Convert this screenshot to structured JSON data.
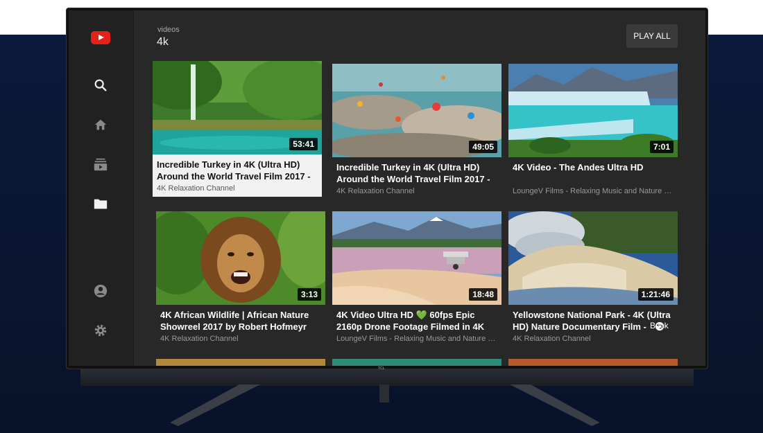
{
  "header": {
    "subtitle": "videos",
    "title": "4k",
    "play_all_label": "PLAY ALL"
  },
  "sidebar": {
    "items": [
      {
        "name": "search",
        "icon": "search-icon"
      },
      {
        "name": "home",
        "icon": "home-icon"
      },
      {
        "name": "subscriptions",
        "icon": "subscriptions-icon"
      },
      {
        "name": "library",
        "icon": "folder-icon"
      },
      {
        "name": "account",
        "icon": "account-icon"
      },
      {
        "name": "settings",
        "icon": "gear-icon"
      }
    ]
  },
  "videos": [
    {
      "title": "Incredible Turkey in 4K (Ultra HD) Around the World Travel Film 2017 -",
      "channel": "4K Relaxation Channel",
      "duration": "53:41",
      "focused": true
    },
    {
      "title": "Incredible Turkey in 4K (Ultra HD) Around the World Travel Film 2017 -",
      "channel": "4K Relaxation Channel",
      "duration": "49:05"
    },
    {
      "title": "4K Video - The Andes Ultra HD",
      "channel": "LoungeV Films - Relaxing Music and Nature S...",
      "duration": "7:01"
    },
    {
      "title": "4K African Wildlife | African Nature Showreel 2017 by Robert Hofmeyr",
      "channel": "4K Relaxation Channel",
      "duration": "3:13"
    },
    {
      "title": "4K Video Ultra HD 💚 60fps Epic 2160p Drone Footage Filmed in 4K",
      "channel": "LoungeV Films - Relaxing Music and Nature S...",
      "duration": "18:48"
    },
    {
      "title": "Yellowstone National Park - 4K (Ultra HD) Nature Documentary Film -",
      "channel": "4K Relaxation Channel",
      "duration": "1:21:46"
    }
  ],
  "back_hint": "Back",
  "tv_brand": "TCL",
  "colors": {
    "youtube_red": "#e62117",
    "background": "#282828",
    "sidebar": "#212121"
  }
}
